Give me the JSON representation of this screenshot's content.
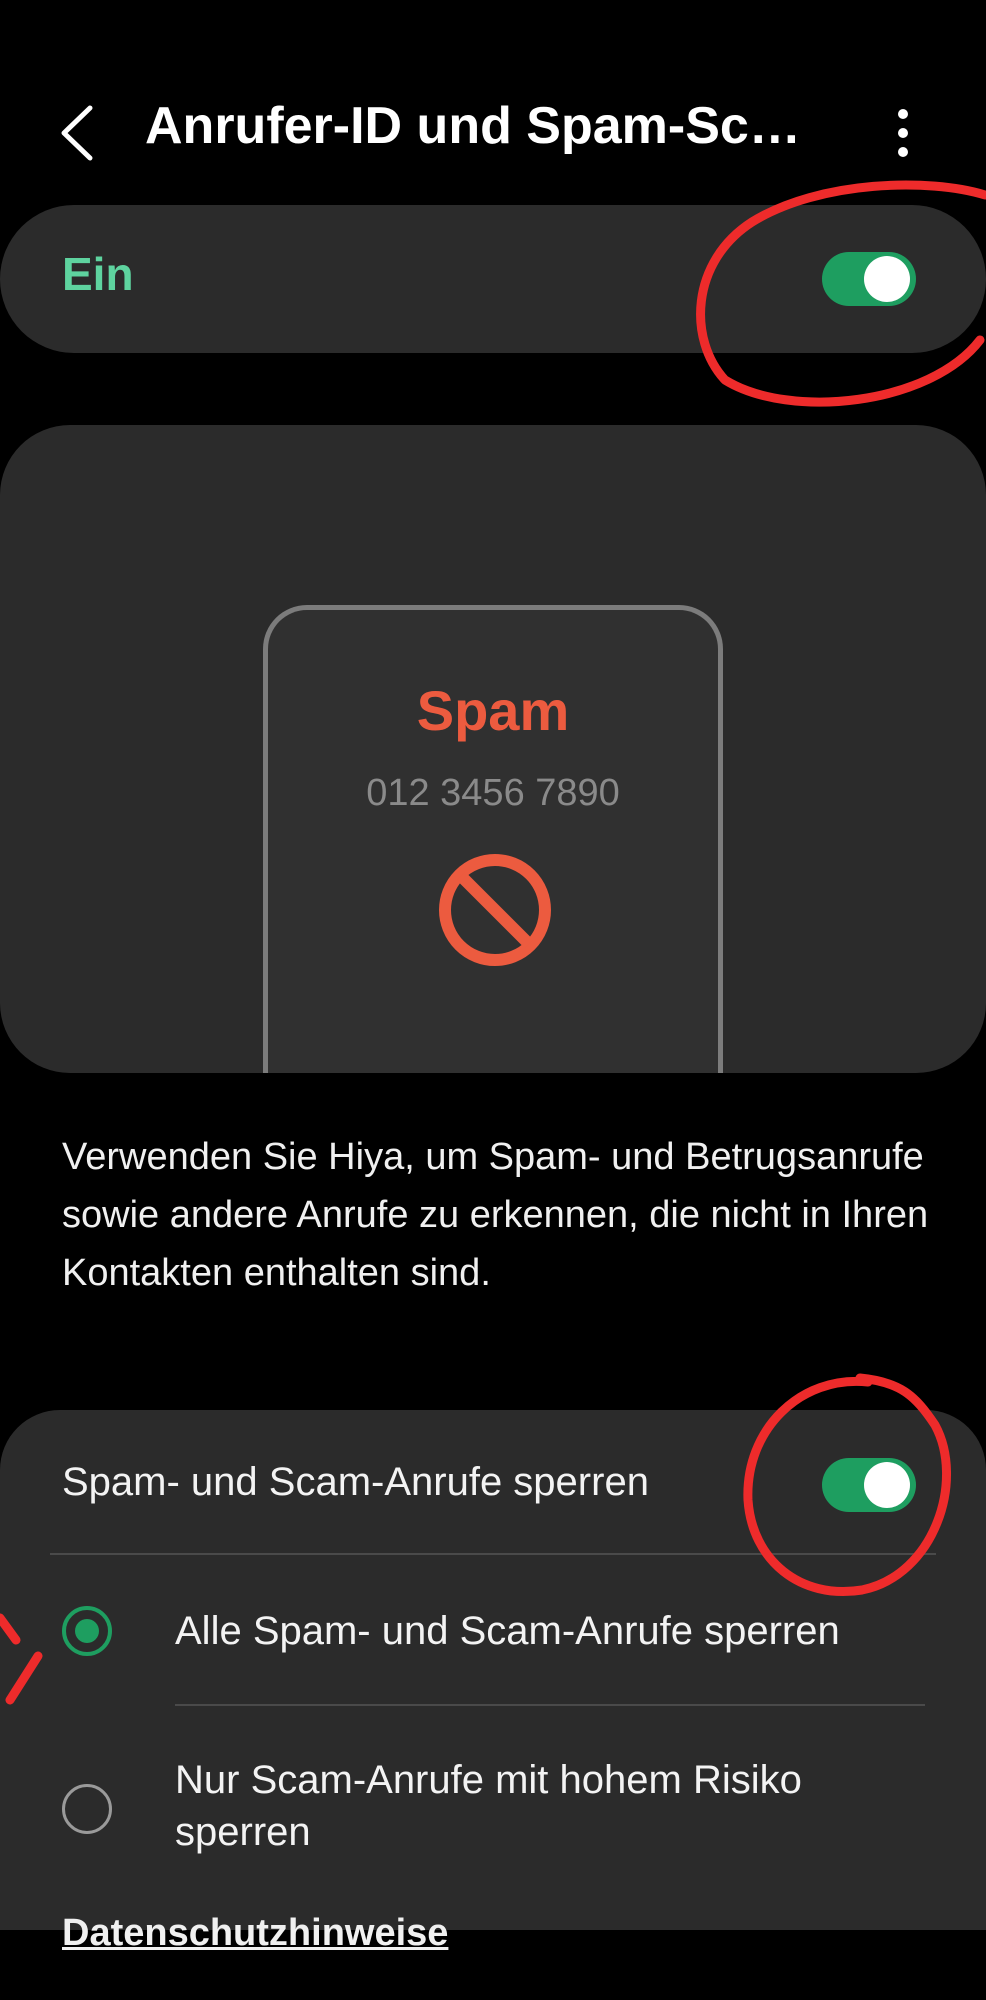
{
  "header": {
    "title": "Anrufer-ID und Spam-Sch…",
    "back_icon": "chevron-left-icon",
    "more_icon": "more-vertical-icon"
  },
  "master_switch": {
    "label": "Ein",
    "state": "on"
  },
  "illustration": {
    "spam_label": "Spam",
    "phone_number": "012 3456 7890",
    "icon": "block-icon"
  },
  "description": "Verwenden Sie Hiya, um Spam- und Betrugsanrufe sowie andere Anrufe zu erkennen, die nicht in Ihren Kontakten enthalten sind.",
  "block_settings": {
    "title": "Spam- und Scam-Anrufe sperren",
    "state": "on",
    "options": [
      {
        "label": "Alle Spam- und Scam-Anrufe sperren",
        "selected": true
      },
      {
        "label": "Nur Scam-Anrufe mit hohem Risiko sperren",
        "selected": false
      }
    ]
  },
  "footer": {
    "privacy_link": "Datenschutzhinweise"
  },
  "colors": {
    "accent_green": "#1e9e60",
    "on_label_green": "#5ed39f",
    "spam_red": "#ec5b3f",
    "card_bg": "#2b2b2b",
    "annotation_red": "#ee2b2b"
  }
}
